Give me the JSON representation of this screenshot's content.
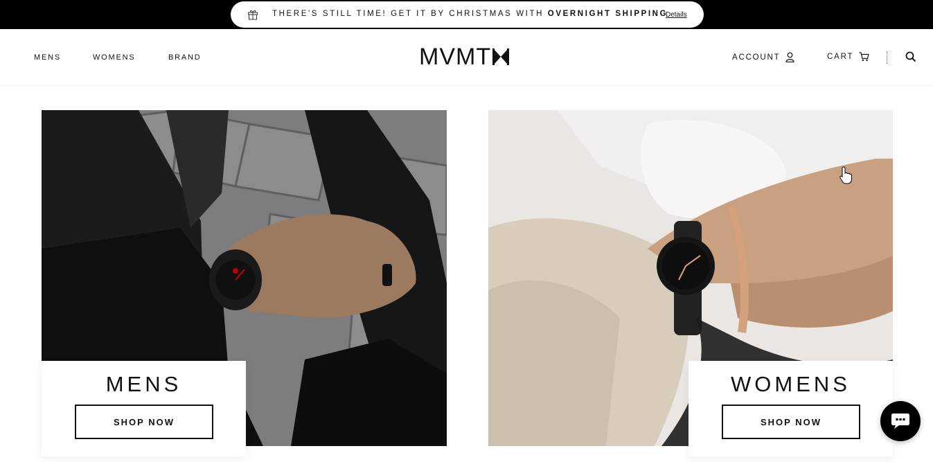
{
  "announcement": {
    "text_prefix": "THERE'S STILL TIME! GET IT BY CHRISTMAS WITH ",
    "text_bold": "OVERNIGHT SHIPPING",
    "link": "Details",
    "icon": "gift-icon"
  },
  "nav": {
    "left": [
      "MENS",
      "WOMENS",
      "BRAND"
    ],
    "logo": "MVMT",
    "account": "ACCOUNT",
    "cart": "CART",
    "icons": [
      "user-icon",
      "cart-icon",
      "search-icon"
    ]
  },
  "tiles": [
    {
      "title": "MENS",
      "button": "SHOP NOW"
    },
    {
      "title": "WOMENS",
      "button": "SHOP NOW"
    }
  ],
  "colors": {
    "bar": "#000000",
    "text": "#111111",
    "background": "#ffffff"
  }
}
